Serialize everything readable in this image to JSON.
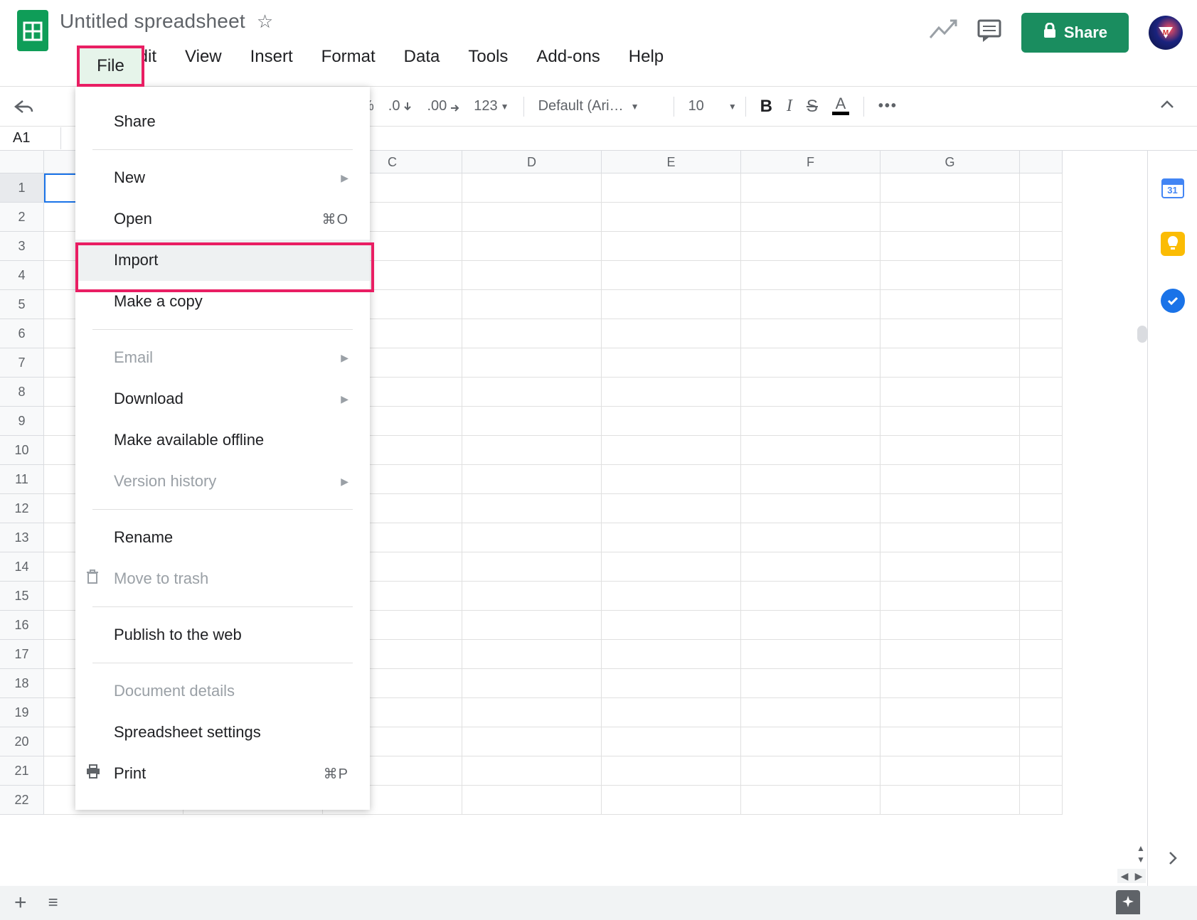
{
  "header": {
    "doc_title": "Untitled spreadsheet",
    "share_label": "Share"
  },
  "menubar": [
    "File",
    "Edit",
    "View",
    "Insert",
    "Format",
    "Data",
    "Tools",
    "Add-ons",
    "Help"
  ],
  "toolbar": {
    "percent": "%",
    "dec_less": ".0",
    "dec_more": ".00",
    "num_format": "123",
    "font_name": "Default (Ari…",
    "font_size": "10"
  },
  "namebox": "A1",
  "columns": [
    "",
    "",
    "C",
    "D",
    "E",
    "F",
    "G"
  ],
  "rows": [
    1,
    2,
    3,
    4,
    5,
    6,
    7,
    8,
    9,
    10,
    11,
    12,
    13,
    14,
    15,
    16,
    17,
    18,
    19,
    20,
    21,
    22
  ],
  "file_menu": {
    "groups": [
      [
        {
          "label": "Share"
        }
      ],
      [
        {
          "label": "New",
          "submenu": true
        },
        {
          "label": "Open",
          "shortcut": "⌘O"
        },
        {
          "label": "Import",
          "highlight": true
        },
        {
          "label": "Make a copy"
        }
      ],
      [
        {
          "label": "Email",
          "submenu": true,
          "disabled": true
        },
        {
          "label": "Download",
          "submenu": true
        },
        {
          "label": "Make available offline"
        },
        {
          "label": "Version history",
          "submenu": true,
          "disabled": true
        }
      ],
      [
        {
          "label": "Rename"
        },
        {
          "label": "Move to trash",
          "disabled": true,
          "icon": "trash"
        }
      ],
      [
        {
          "label": "Publish to the web"
        }
      ],
      [
        {
          "label": "Document details",
          "disabled": true
        },
        {
          "label": "Spreadsheet settings"
        },
        {
          "label": "Print",
          "shortcut": "⌘P",
          "icon": "print"
        }
      ]
    ]
  },
  "side_panel": {
    "calendar_day": "31"
  }
}
